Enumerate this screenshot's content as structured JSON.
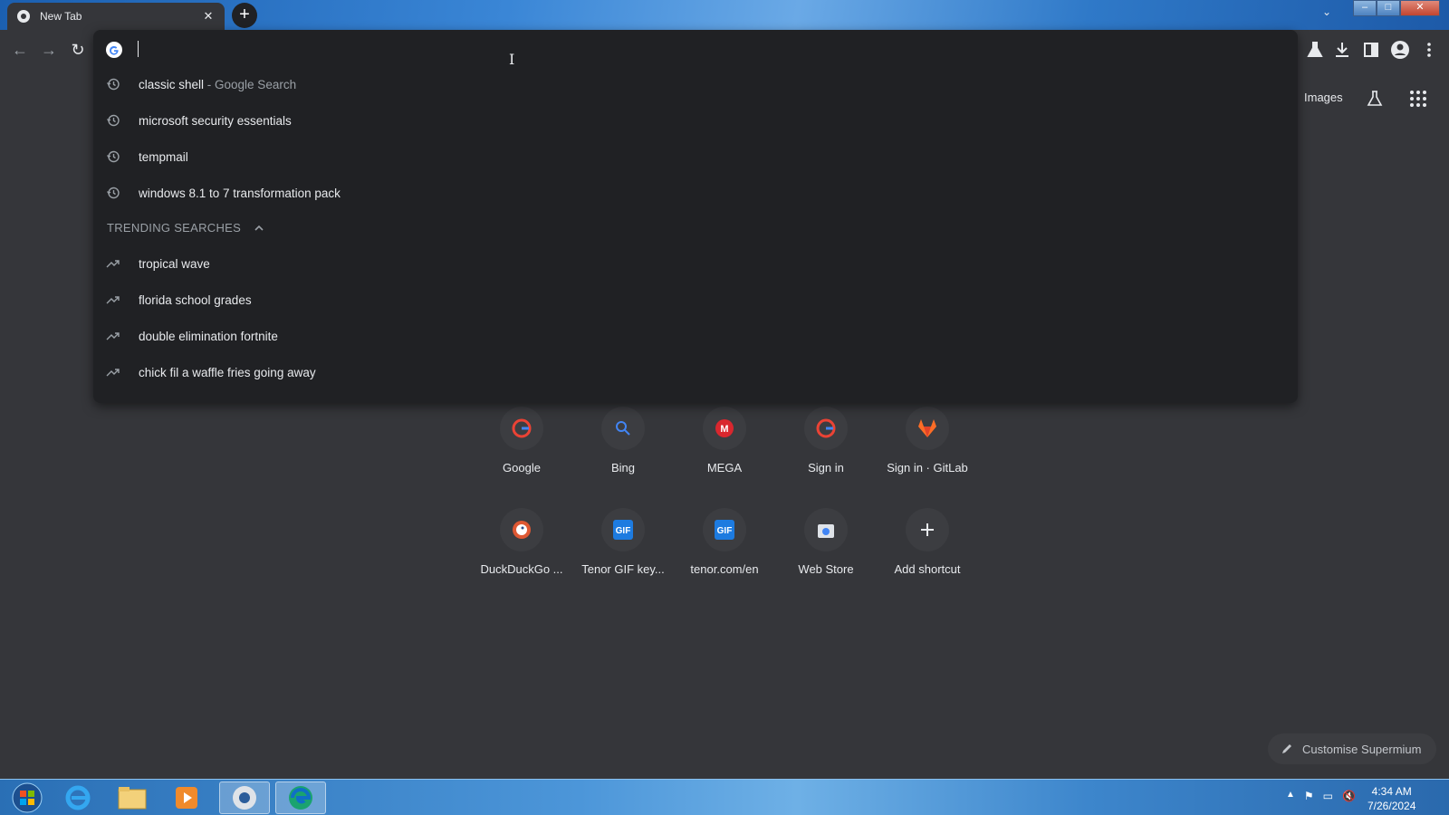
{
  "browser": {
    "tab_title": "New Tab",
    "tab_close": "✕",
    "new_tab": "+"
  },
  "omnibox": {
    "history": [
      {
        "text": "classic shell",
        "suffix": " - Google Search"
      },
      {
        "text": "microsoft security essentials",
        "suffix": ""
      },
      {
        "text": "tempmail",
        "suffix": ""
      },
      {
        "text": "windows 8.1 to 7 transformation pack",
        "suffix": ""
      }
    ],
    "trending_header": "TRENDING SEARCHES",
    "trending": [
      "tropical wave",
      "florida school grades",
      "double elimination fortnite",
      "chick fil a waffle fries going away"
    ]
  },
  "ntp": {
    "images_link": "Images",
    "shortcuts": [
      {
        "label": "Google",
        "icon": "google-icon"
      },
      {
        "label": "Bing",
        "icon": "bing-icon"
      },
      {
        "label": "MEGA",
        "icon": "mega-icon"
      },
      {
        "label": "Sign in",
        "icon": "google-icon"
      },
      {
        "label": "Sign in · GitLab",
        "icon": "gitlab-icon"
      },
      {
        "label": "DuckDuckGo ...",
        "icon": "duckduckgo-icon"
      },
      {
        "label": "Tenor GIF key...",
        "icon": "gif-icon"
      },
      {
        "label": "tenor.com/en",
        "icon": "gif-icon"
      },
      {
        "label": "Web Store",
        "icon": "webstore-icon"
      },
      {
        "label": "Add shortcut",
        "icon": "plus-icon"
      }
    ],
    "customise": "Customise Supermium"
  },
  "taskbar": {
    "time": "4:34 AM",
    "date": "7/26/2024"
  }
}
